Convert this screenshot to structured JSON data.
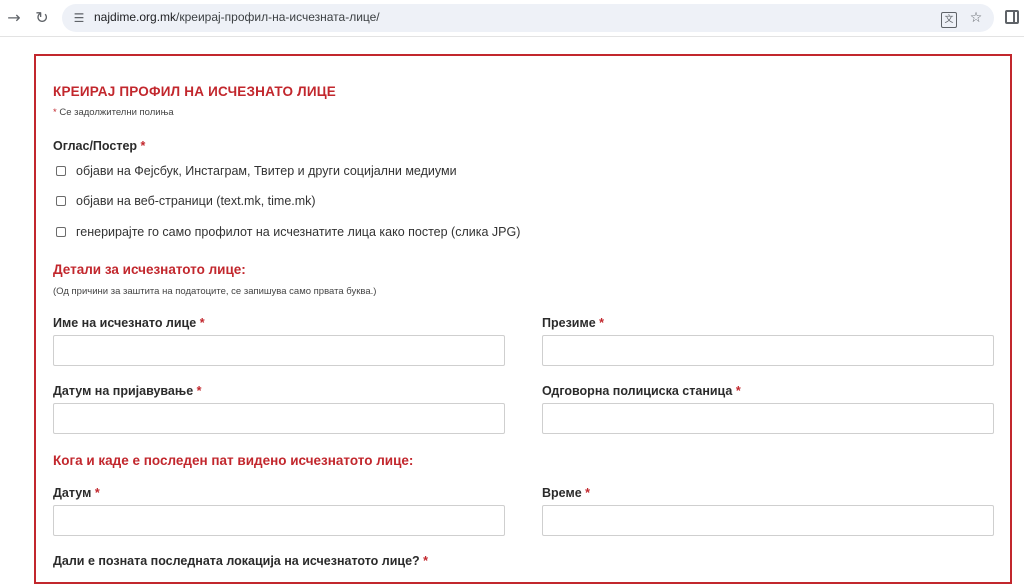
{
  "browser": {
    "url_host": "najdime.org.mk",
    "url_path": "/креирај-профил-на-исчезната-лице/"
  },
  "form": {
    "title": "КРЕИРАЈ ПРОФИЛ НА ИСЧЕЗНАТО ЛИЦЕ",
    "required_star": "*",
    "required_note": "Се задолжителни полиња",
    "poster": {
      "label": "Оглас/Постер",
      "options": [
        "објави на Фејсбук, Инстаграм, Твитер и други социјални медиуми",
        "објави на веб-страници (text.mk, time.mk)",
        "генерирајте го само профилот на исчезнатите лица како постер (слика JPG)"
      ]
    },
    "details": {
      "heading": "Детали за исчезнатото лице:",
      "note": "(Од причини за заштита на податоците, се запишува само првата буква.)",
      "first_name_label": "Име на исчезнато лице",
      "last_name_label": "Презиме",
      "report_date_label": "Датум на пријавување",
      "police_station_label": "Одговорна полициска станица"
    },
    "last_seen": {
      "heading": "Кога и каде е последен пат видено исчезнатото лице:",
      "date_label": "Датум",
      "time_label": "Време",
      "location_question": "Дали е позната последната локација на исчезнатото лице?"
    }
  }
}
